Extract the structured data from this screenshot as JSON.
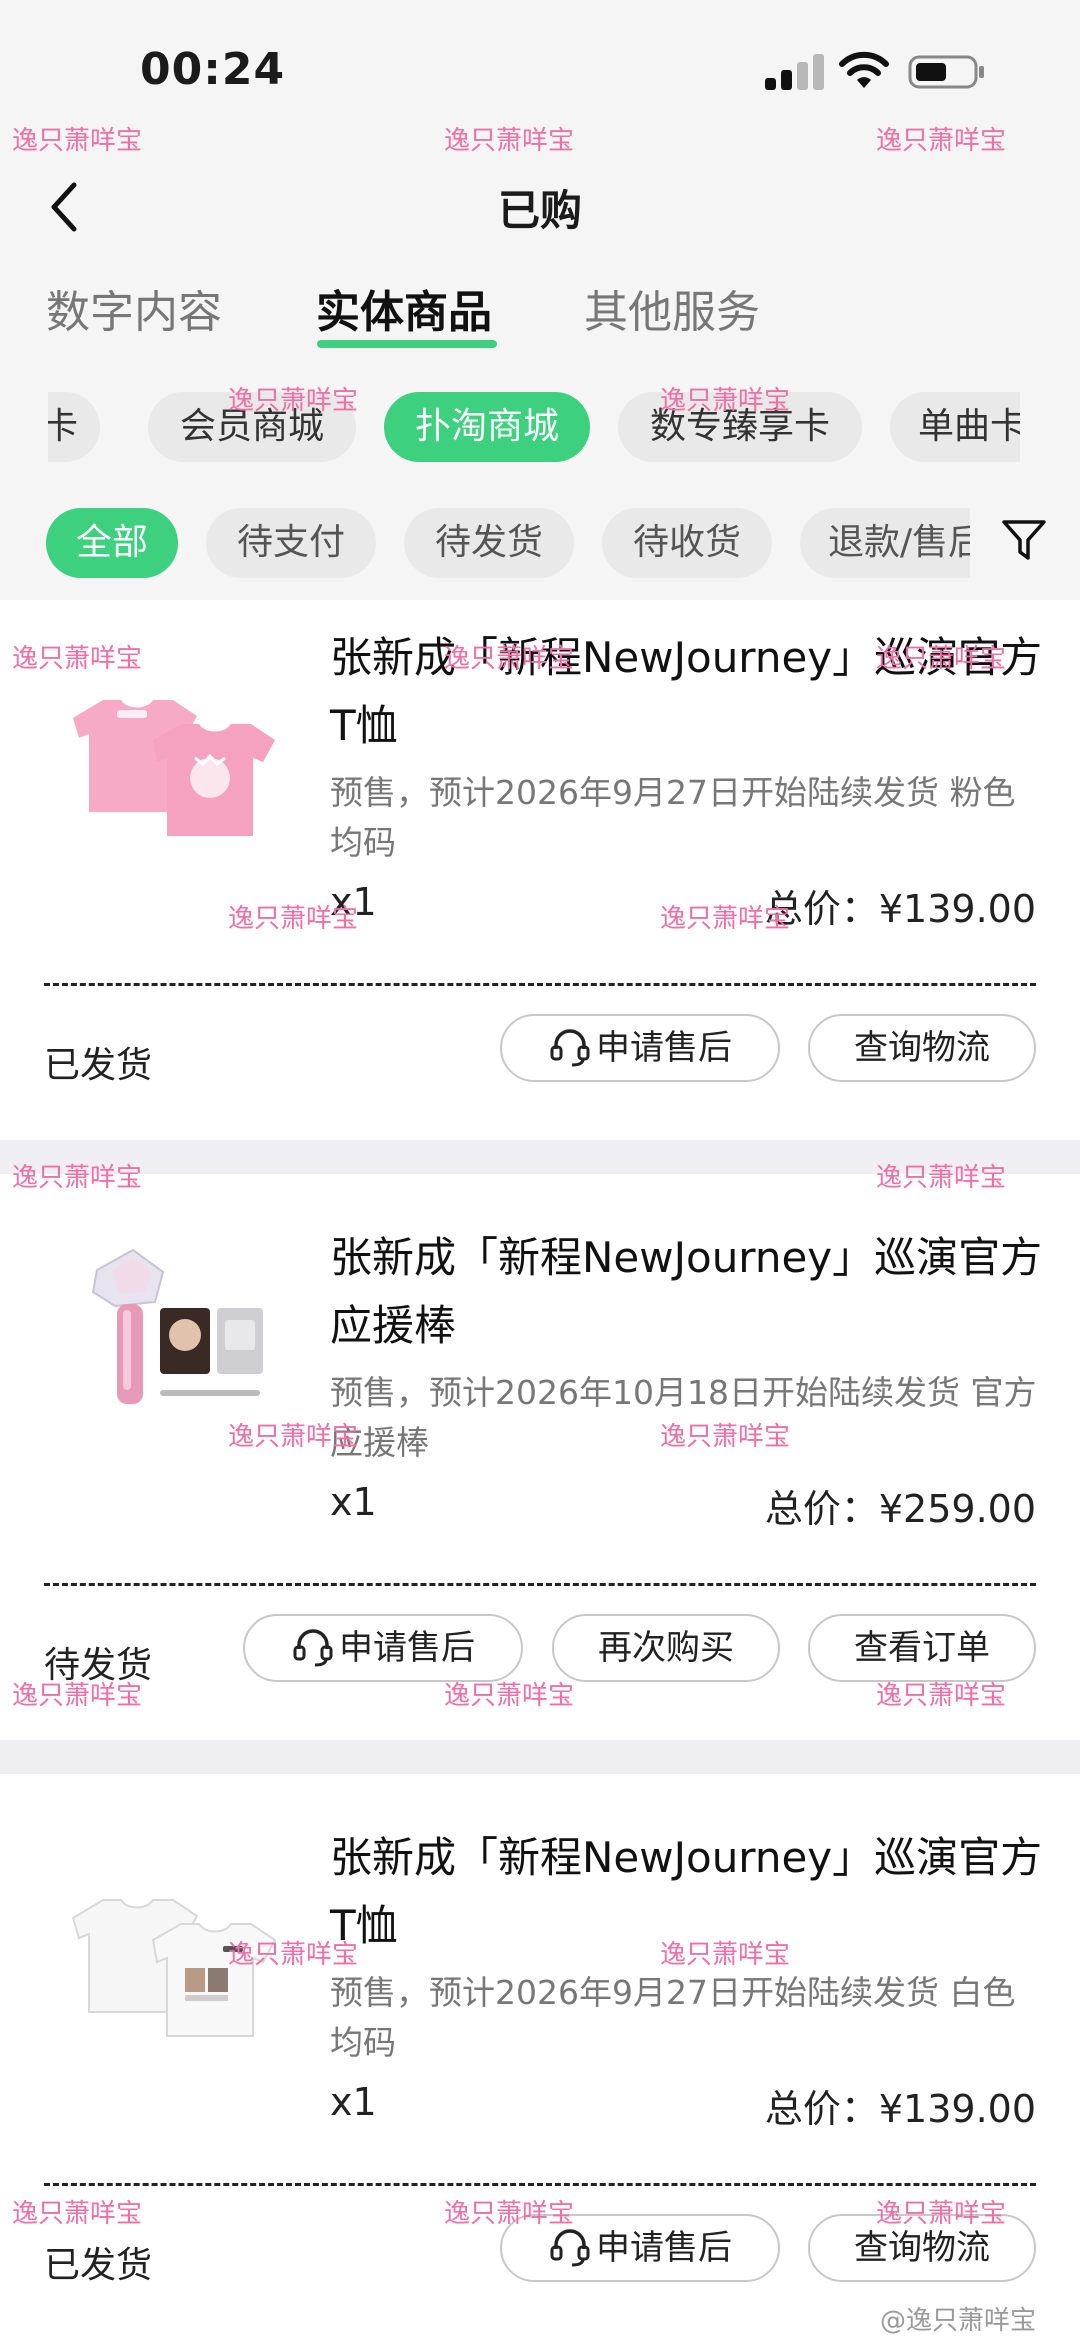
{
  "status_bar": {
    "time": "00:24"
  },
  "nav": {
    "title": "已购"
  },
  "tabs": [
    {
      "label": "数字内容",
      "active": false
    },
    {
      "label": "实体商品",
      "active": true
    },
    {
      "label": "其他服务",
      "active": false
    }
  ],
  "categories": [
    {
      "label": "卡",
      "active": false
    },
    {
      "label": "会员商城",
      "active": false
    },
    {
      "label": "扑淘商城",
      "active": true
    },
    {
      "label": "数专臻享卡",
      "active": false
    },
    {
      "label": "单曲卡",
      "active": false
    }
  ],
  "filters": [
    {
      "label": "全部",
      "active": true
    },
    {
      "label": "待支付",
      "active": false
    },
    {
      "label": "待发货",
      "active": false
    },
    {
      "label": "待收货",
      "active": false
    },
    {
      "label": "退款/售后",
      "active": false
    }
  ],
  "orders": [
    {
      "title": "张新成「新程NewJourney」巡演官方T恤",
      "desc": "预售，预计2026年9月27日开始陆续发货 粉色 均码",
      "qty": "x1",
      "total": "总价：¥139.00",
      "status": "已发货",
      "buttons": [
        "申请售后",
        "查询物流"
      ]
    },
    {
      "title": "张新成「新程NewJourney」巡演官方应援棒",
      "desc": "预售，预计2026年10月18日开始陆续发货 官方应援棒",
      "qty": "x1",
      "total": "总价：¥259.00",
      "status": "待发货",
      "buttons": [
        "申请售后",
        "再次购买",
        "查看订单"
      ]
    },
    {
      "title": "张新成「新程NewJourney」巡演官方T恤",
      "desc": "预售，预计2026年9月27日开始陆续发货 白色 均码",
      "qty": "x1",
      "total": "总价：¥139.00",
      "status": "已发货",
      "buttons": [
        "申请售后",
        "查询物流"
      ]
    }
  ],
  "watermark": {
    "text": "逸只萧咩宝",
    "weibo": "@逸只萧咩宝"
  },
  "colors": {
    "accent": "#3dd07e",
    "watermark": "#f06fa6",
    "page_bg": "#f5f5f5"
  }
}
